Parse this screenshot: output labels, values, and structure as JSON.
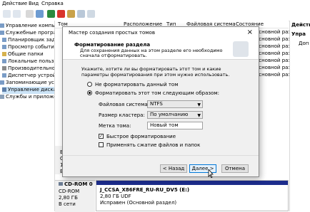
{
  "menu": [
    "Действие",
    "Вид",
    "Справка"
  ],
  "tree": {
    "items": [
      {
        "label": "Управление компьютером (л"
      },
      {
        "label": "Служебные программы"
      },
      {
        "label": "Планировщик задан"
      },
      {
        "label": "Просмотр событий"
      },
      {
        "label": "Общие папки"
      },
      {
        "label": "Локальные пользов"
      },
      {
        "label": "Производительность"
      },
      {
        "label": "Диспетчер устройств"
      },
      {
        "label": "Запоминающие устройст"
      },
      {
        "label": "Управление дисками"
      },
      {
        "label": "Службы и приложения"
      }
    ]
  },
  "columns": [
    "Том",
    "Расположение",
    "Тип",
    "Файловая система",
    "Состояние"
  ],
  "volume_list": [
    "(Основной разд",
    "(Основной разд",
    "(Основной разд",
    "(Основной разд",
    "(Основной разд",
    "(Основной разд",
    "(Основной разд"
  ],
  "actions": {
    "header": "Действ",
    "item1": "Упра",
    "item2": "Доп"
  },
  "diskmap": {
    "disk_side": [
      "Ба",
      "Ос",
      "16",
      "В"
    ],
    "cd": {
      "name": "CD-ROM 0",
      "type": "CD-ROM",
      "size": "2,80 ГБ",
      "status": "В сети"
    },
    "cd_volume": {
      "label": "J_CCSA_X86FRE_RU-RU_DV5  (E:)",
      "size": "2,80 ГБ UDF",
      "status": "Исправен (Основной раздел)"
    }
  },
  "dialog": {
    "title": "Мастер создания простых томов",
    "close": "×",
    "heading": "Форматирование раздела",
    "subheading": "Для сохранения данных на этом разделе его необходимо сначала отформатировать.",
    "instruction": "Укажите, хотите ли вы форматировать этот том и какие параметры форматирования при этом нужно использовать.",
    "radio_noformat": "Не форматировать данный том",
    "radio_format": "Форматировать этот том следующим образом:",
    "fs_label": "Файловая система:",
    "fs_value": "NTFS",
    "cluster_label": "Размер кластера:",
    "cluster_value": "По умолчанию",
    "volume_label": "Метка тома:",
    "volume_value": "Новый том",
    "quick_format": "Быстрое форматирование",
    "compression": "Применять сжатие файлов и папок",
    "back": "< Назад",
    "next": "Далее >",
    "cancel": "Отмена"
  }
}
